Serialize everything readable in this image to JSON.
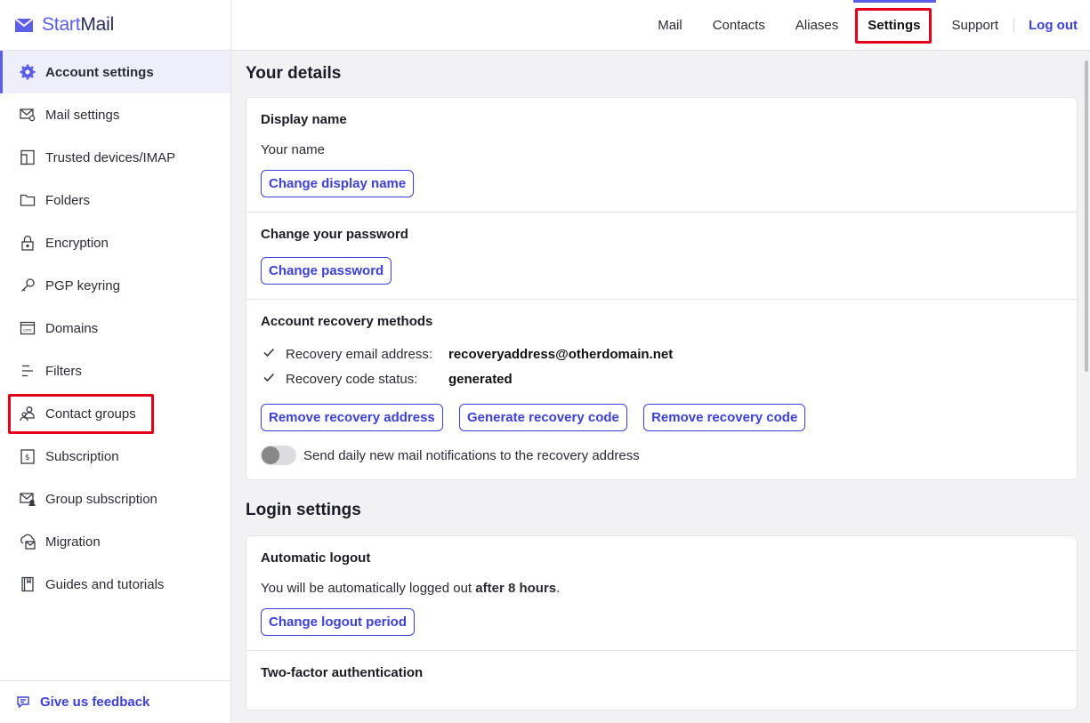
{
  "brand": {
    "start": "Start",
    "mail": "Mail",
    "accent": "#5b5fe8",
    "highlight": "#e4001b"
  },
  "sidebar": {
    "items": [
      {
        "label": "Account settings",
        "icon": "gear-icon",
        "active": true
      },
      {
        "label": "Mail settings",
        "icon": "mail-settings-icon"
      },
      {
        "label": "Trusted devices/IMAP",
        "icon": "device-icon"
      },
      {
        "label": "Folders",
        "icon": "folder-icon"
      },
      {
        "label": "Encryption",
        "icon": "lock-icon"
      },
      {
        "label": "PGP keyring",
        "icon": "key-icon"
      },
      {
        "label": "Domains",
        "icon": "domain-icon"
      },
      {
        "label": "Filters",
        "icon": "filter-icon"
      },
      {
        "label": "Contact groups",
        "icon": "contact-groups-icon",
        "highlighted": true
      },
      {
        "label": "Subscription",
        "icon": "subscription-icon"
      },
      {
        "label": "Group subscription",
        "icon": "group-subscription-icon"
      },
      {
        "label": "Migration",
        "icon": "migration-icon"
      },
      {
        "label": "Guides and tutorials",
        "icon": "book-icon"
      }
    ],
    "feedback": "Give us feedback"
  },
  "topnav": {
    "tabs": [
      "Mail",
      "Contacts",
      "Aliases",
      "Settings",
      "Support"
    ],
    "active": "Settings",
    "logout": "Log out"
  },
  "details": {
    "title": "Your details",
    "display_name": {
      "heading": "Display name",
      "value": "Your name",
      "button": "Change display name"
    },
    "password": {
      "heading": "Change your password",
      "button": "Change password"
    },
    "recovery": {
      "heading": "Account recovery methods",
      "email_label": "Recovery email address:",
      "email_value": "recoveryaddress@otherdomain.net",
      "code_label": "Recovery code status:",
      "code_value": "generated",
      "btn_remove_address": "Remove recovery address",
      "btn_generate_code": "Generate recovery code",
      "btn_remove_code": "Remove recovery code",
      "toggle_label": "Send daily new mail notifications to the recovery address",
      "toggle_on": false
    }
  },
  "login": {
    "title": "Login settings",
    "auto_logout": {
      "heading": "Automatic logout",
      "text_before": "You will be automatically logged out ",
      "text_bold": "after 8 hours",
      "text_after": ".",
      "button": "Change logout period"
    },
    "two_factor": {
      "heading": "Two-factor authentication"
    }
  }
}
